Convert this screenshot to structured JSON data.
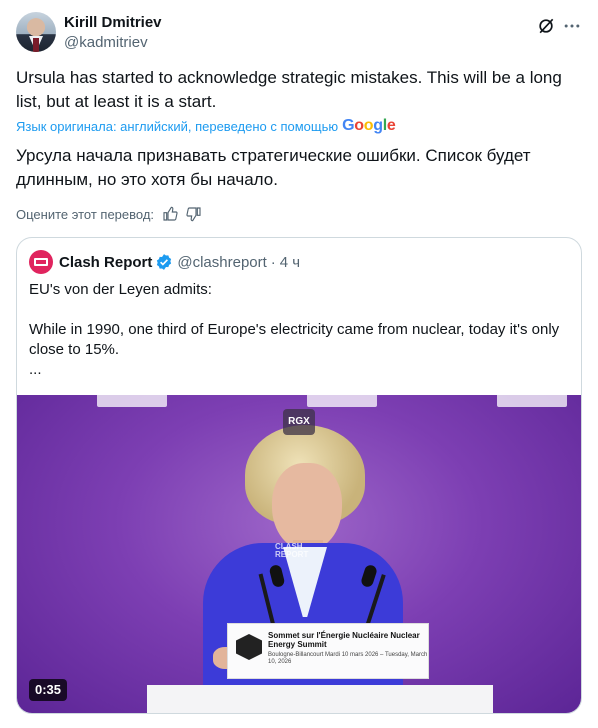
{
  "author": {
    "name": "Kirill Dmitriev",
    "handle": "@kadmitriev"
  },
  "tweet": {
    "text": "Ursula has started to acknowledge strategic mistakes. This will be a long list, but at least it is a start.",
    "translated_by": "Язык оригинала: английский, переведено с помощью",
    "translated_by_brand": "Google",
    "translated_text": "Урсула начала признавать стратегические ошибки. Список будет длинным, но это хотя бы начало.",
    "rate_label": "Оцените этот перевод:"
  },
  "quoted": {
    "name": "Clash Report",
    "handle": "@clashreport",
    "separator": "·",
    "time": "4 ч",
    "line1": "EU's von der Leyen admits:",
    "line2": "While in 1990, one third of Europe's electricity came from nuclear, today it's only close to 15%.",
    "line3": "...",
    "video": {
      "overlay_label": "RGX",
      "watermark": "CLASH REPORT",
      "podium_title": "Sommet sur l'Énergie Nucléaire Nuclear Energy Summit",
      "podium_subtitle": "Boulogne-Billancourt Mardi 10 mars 2026 – Tuesday, March 10, 2026",
      "duration": "0:35"
    }
  },
  "colors": {
    "accent": "#1d9bf0",
    "quote_badge": "#e0245e",
    "verified": "#1d9bf0"
  },
  "icons": {
    "grok": "grok-icon",
    "more": "more-icon",
    "thumbs_up": "thumbs-up-icon",
    "thumbs_down": "thumbs-down-icon",
    "verified": "verified-badge-icon"
  }
}
